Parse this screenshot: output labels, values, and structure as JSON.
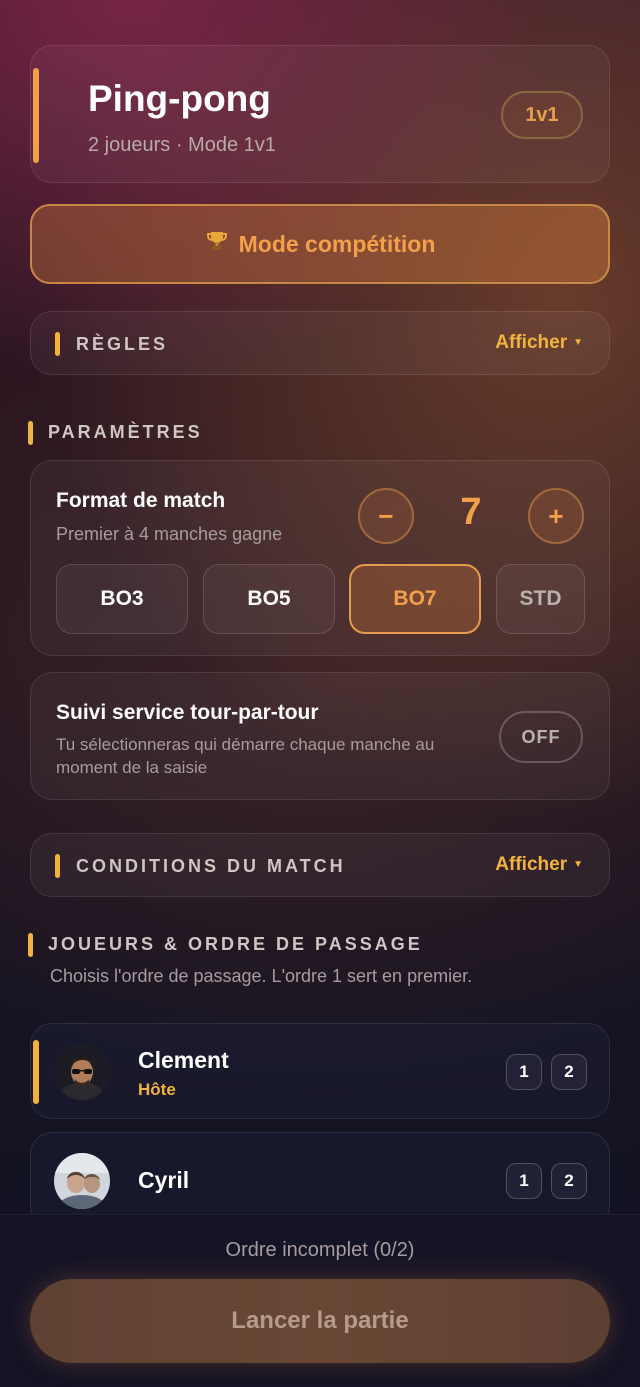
{
  "header": {
    "title": "Ping-pong",
    "subtitle": "2 joueurs · Mode 1v1",
    "mode_badge": "1v1"
  },
  "competition": {
    "label": "Mode compétition",
    "icon": "trophy-icon"
  },
  "rules": {
    "title": "RÈGLES",
    "toggle": "Afficher"
  },
  "parameters": {
    "title": "PARAMÈTRES",
    "format": {
      "title": "Format de match",
      "subtitle": "Premier à 4 manches gagne",
      "minus": "−",
      "plus": "+",
      "value": "7",
      "presets": [
        "BO3",
        "BO5",
        "BO7",
        "STD"
      ],
      "selected": "BO7"
    },
    "service": {
      "title": "Suivi service tour-par-tour",
      "description": "Tu sélectionneras qui démarre chaque manche au moment de la saisie",
      "state": "OFF"
    }
  },
  "conditions": {
    "title": "CONDITIONS DU MATCH",
    "toggle": "Afficher"
  },
  "players": {
    "title": "JOUEURS & ORDRE DE PASSAGE",
    "hint": "Choisis l'ordre de passage. L'ordre 1 sert en premier.",
    "list": [
      {
        "name": "Clement",
        "role": "Hôte",
        "orders": [
          "1",
          "2"
        ]
      },
      {
        "name": "Cyril",
        "role": "",
        "orders": [
          "1",
          "2"
        ]
      }
    ]
  },
  "footer": {
    "status": "Ordre incomplet (0/2)",
    "launch": "Lancer la partie"
  },
  "colors": {
    "accent": "#f2a04a",
    "accent_yellow": "#f2b33e"
  }
}
